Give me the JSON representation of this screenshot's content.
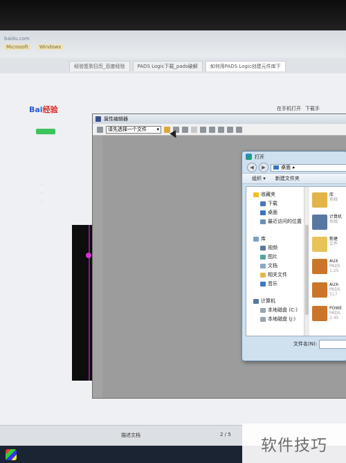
{
  "browser": {
    "address": "baidu.com",
    "bookmarks": [
      "Microsoft",
      "Windows"
    ],
    "tabs": [
      {
        "label": "经验签到日历_百度经验",
        "active": false
      },
      {
        "label": "PADS Logic下载_pads破解",
        "active": false
      },
      {
        "label": "如何用PADS Logic创建元件库下",
        "active": true
      }
    ],
    "open_phone": "在手机打开",
    "download": "下载手",
    "tab_label": "描述文档",
    "page_counter": "2 / 5",
    "logo_text": "Bai",
    "logo_suffix": "经验"
  },
  "property_editor": {
    "title": "属性编辑器",
    "dropdown_value": "请先选择一个文件"
  },
  "open_dialog": {
    "title": "打开",
    "path": "桌面",
    "organize": "组织 ▾",
    "new_folder": "新建文件夹",
    "sidebar": [
      {
        "label": "收藏夹",
        "color": "#f0c21c",
        "sub": false
      },
      {
        "label": "下载",
        "color": "#4a78b8",
        "sub": true
      },
      {
        "label": "桌面",
        "color": "#3a72c9",
        "sub": true
      },
      {
        "label": "最近访问的位置",
        "color": "#6a8fb8",
        "sub": true
      },
      {
        "label": "库",
        "color": "#7ba0c4",
        "sub": false
      },
      {
        "label": "视频",
        "color": "#5b7aa1",
        "sub": true
      },
      {
        "label": "图片",
        "color": "#52a4a0",
        "sub": true
      },
      {
        "label": "文档",
        "color": "#8aa8c6",
        "sub": true
      },
      {
        "label": "相关文件",
        "color": "#e1b94b",
        "sub": true
      },
      {
        "label": "音乐",
        "color": "#3f78c5",
        "sub": true
      },
      {
        "label": "计算机",
        "color": "#5778a2",
        "sub": false
      },
      {
        "label": "本地磁盘 (C:)",
        "color": "#9aa4ae",
        "sub": true
      },
      {
        "label": "本地磁盘 (J:)",
        "color": "#9aa4ae",
        "sub": true
      }
    ],
    "files": [
      {
        "name": "库",
        "meta1": "系统",
        "meta2": "",
        "color": "#e3b44a"
      },
      {
        "name": "计算机",
        "meta1": "系统",
        "meta2": "",
        "color": "#5878a2"
      },
      {
        "name": "新建",
        "meta1": "文件",
        "meta2": "",
        "color": "#e8c35a"
      },
      {
        "name": "AUX",
        "meta1": "PADS",
        "meta2": "1.25",
        "color": "#c9762b"
      },
      {
        "name": "AUX-",
        "meta1": "PADS",
        "meta2": "517",
        "color": "#c9762b"
      },
      {
        "name": "POWE",
        "meta1": "PADS",
        "meta2": "2.45",
        "color": "#c9762b"
      }
    ],
    "filename_label": "文件名(N):"
  },
  "watermark": "软件技巧"
}
